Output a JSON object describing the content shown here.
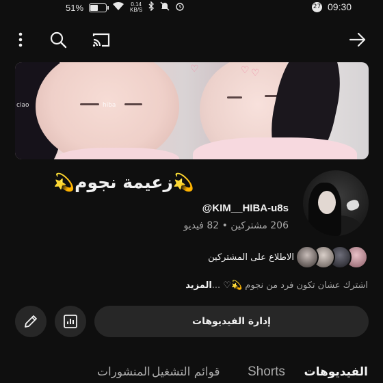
{
  "status_bar": {
    "battery": "51%",
    "net_speed_value": "0.14",
    "net_speed_unit": "KB/S",
    "notification_count": "27",
    "time": "09:30"
  },
  "channel": {
    "name": "💫زعيمة نجوم💫",
    "handle": "@KIM__HIBA-u8s",
    "stats": "206 مشتركين • 82 فيديو",
    "subscribers_link": "الاطلاع على المشتركين",
    "description": "اشترك عشان تكون فرد من نجوم 💫♡ ...",
    "more_label": "المزيد"
  },
  "actions": {
    "manage_videos": "إدارة الفيديوهات"
  },
  "tabs": [
    {
      "label": "الفيديوهات",
      "active": true
    },
    {
      "label": "Shorts",
      "active": false
    },
    {
      "label": "قوائم التشغيل",
      "active": false
    },
    {
      "label": "المنشورات",
      "active": false
    }
  ],
  "banner_overlay": {
    "left_text": "ciao",
    "mid_text": "hiba"
  },
  "colors": {
    "background": "#0f0f0f",
    "button": "#272727",
    "secondary_text": "#aaaaaa",
    "primary_text": "#f1f1f1"
  }
}
